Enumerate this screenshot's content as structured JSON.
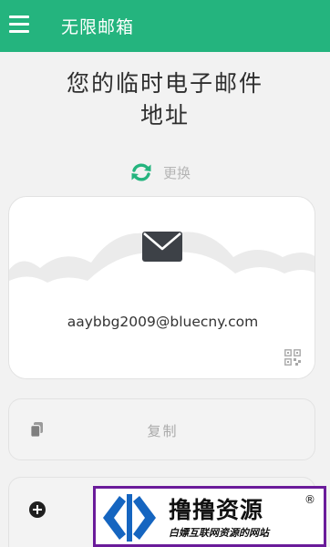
{
  "app": {
    "title": "无限邮箱"
  },
  "header": {
    "headline_line1": "您的临时电子邮件",
    "headline_line2": "地址"
  },
  "refresh": {
    "label": "更换"
  },
  "mailbox": {
    "email": "aaybbg2009@bluecny.com"
  },
  "actions": {
    "copy_label": "复制"
  },
  "watermark": {
    "title": "撸撸资源",
    "registered": "®",
    "subtitle": "白嫖互联网资源的网站"
  },
  "colors": {
    "primary": "#24b47e",
    "icon_dark": "#3d4147",
    "watermark_border": "#6a1b9a",
    "watermark_blue": "#1565c0"
  },
  "icons": {
    "menu": "menu-icon",
    "refresh": "refresh-icon",
    "envelope": "envelope-icon",
    "qr": "qr-code-icon",
    "copy": "copy-icon",
    "add": "plus-circle-icon"
  }
}
